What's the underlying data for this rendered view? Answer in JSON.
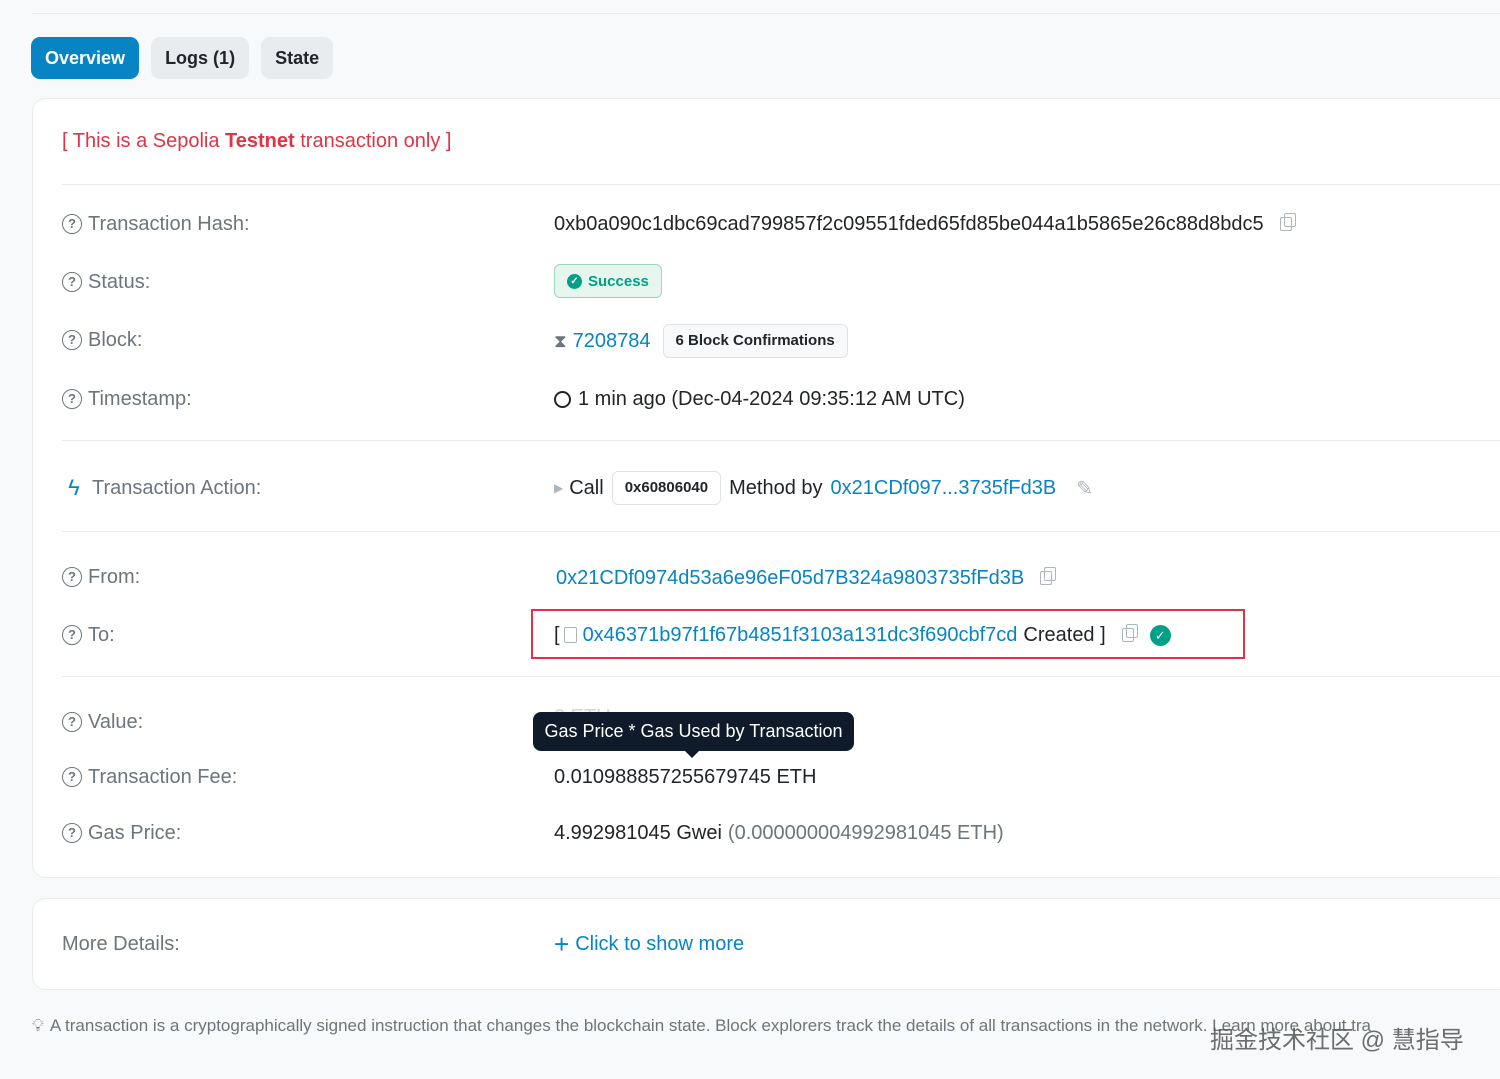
{
  "tabs": [
    {
      "label": "Overview",
      "active": true
    },
    {
      "label": "Logs (1)",
      "active": false
    },
    {
      "label": "State",
      "active": false
    }
  ],
  "notice": {
    "prefix": "[ This is a Sepolia ",
    "bold": "Testnet",
    "suffix": " transaction only ]"
  },
  "fields": {
    "tx_hash": {
      "label": "Transaction Hash:",
      "value": "0xb0a090c1dbc69cad799857f2c09551fded65fd85be044a1b5865e26c88d8bdc5"
    },
    "status": {
      "label": "Status:",
      "value": "Success"
    },
    "block": {
      "label": "Block:",
      "value": "7208784",
      "confirmations": "6 Block Confirmations"
    },
    "timestamp": {
      "label": "Timestamp:",
      "value": "1 min ago (Dec-04-2024 09:35:12 AM UTC)"
    },
    "action": {
      "label": "Transaction Action:",
      "call": "Call",
      "method_id": "0x60806040",
      "method_by": "Method by",
      "address": "0x21CDf097...3735fFd3B"
    },
    "from": {
      "label": "From:",
      "value": "0x21CDf0974d53a6e96eF05d7B324a9803735fFd3B"
    },
    "to": {
      "label": "To:",
      "open": "[",
      "address": "0x46371b97f1f67b4851f3103a131dc3f690cbf7cd",
      "created": "Created ]"
    },
    "value": {
      "label": "Value:",
      "value": "0 ETH"
    },
    "fee": {
      "label": "Transaction Fee:",
      "value": "0.010988857255679745 ETH"
    },
    "gas_price": {
      "label": "Gas Price:",
      "gwei": "4.992981045 Gwei",
      "eth": "(0.000000004992981045 ETH)"
    }
  },
  "tooltip": "Gas Price * Gas Used by Transaction",
  "more_details": {
    "label": "More Details:",
    "link": "Click to show more",
    "plus": "+"
  },
  "footer": "A transaction is a cryptographically signed instruction that changes the blockchain state. Block explorers track the details of all transactions in the network. Learn more about tra",
  "watermark": "掘金技术社区 @ 慧指导",
  "colors": {
    "accent": "#0784c3",
    "success": "#00a186",
    "danger": "#dc3545"
  }
}
